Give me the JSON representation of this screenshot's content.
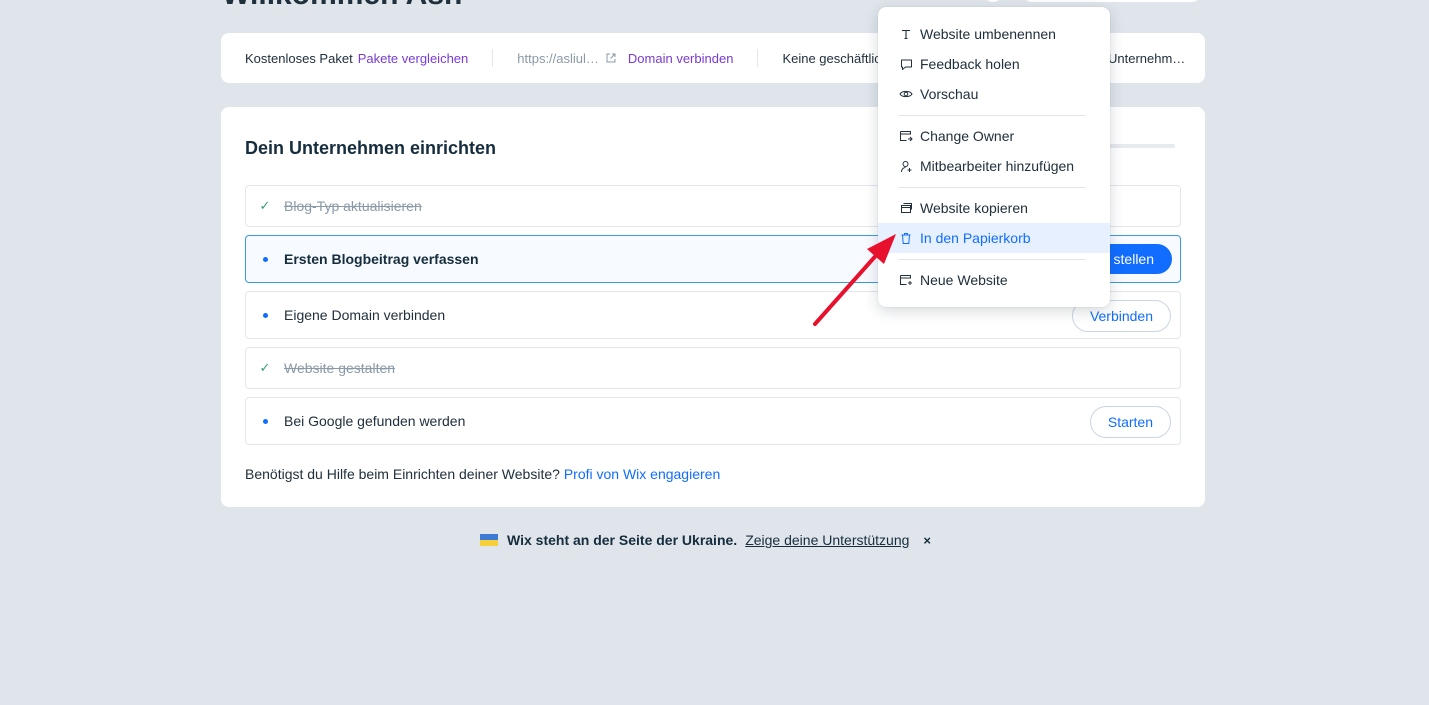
{
  "header": {
    "title_partial": "Willkommen Ash"
  },
  "info_bar": {
    "plan": "Kostenloses Paket",
    "compare_plans": "Pakete vergleichen",
    "url": "https://asliul…",
    "connect_domain": "Domain verbinden",
    "business_email": "Keine geschäftliche",
    "business_name": "Unternehm…"
  },
  "setup": {
    "title": "Dein Unternehmen einrichten",
    "tasks": [
      {
        "label": "Blog-Typ aktualisieren",
        "done": true
      },
      {
        "label": "Ersten Blogbeitrag verfassen",
        "done": false,
        "button": "stellen"
      },
      {
        "label": "Eigene Domain verbinden",
        "done": false,
        "button": "Verbinden"
      },
      {
        "label": "Website gestalten",
        "done": true
      },
      {
        "label": "Bei Google gefunden werden",
        "done": false,
        "button": "Starten"
      }
    ],
    "help_text": "Benötigst du Hilfe beim Einrichten deiner Website?",
    "help_link": "Profi von Wix engagieren"
  },
  "banner": {
    "message": "Wix steht an der Seite der Ukraine.",
    "link": "Zeige deine Unterstützung",
    "close": "×"
  },
  "menu": {
    "items": [
      {
        "label": "Website umbenennen",
        "icon": "text-icon"
      },
      {
        "label": "Feedback holen",
        "icon": "speech-bubble-icon"
      },
      {
        "label": "Vorschau",
        "icon": "eye-icon"
      },
      {
        "label": "Change Owner",
        "icon": "transfer-icon"
      },
      {
        "label": "Mitbearbeiter hinzufügen",
        "icon": "add-person-icon"
      },
      {
        "label": "Website kopieren",
        "icon": "copy-icon"
      },
      {
        "label": "In den Papierkorb",
        "icon": "trash-icon",
        "highlighted": true
      },
      {
        "label": "Neue Website",
        "icon": "new-site-icon"
      }
    ]
  },
  "colors": {
    "background": "#dfe5eb",
    "accent": "#116dff",
    "purple_link": "#7a3bd1",
    "arrow": "#e8112d",
    "highlight": "#e7f0ff"
  }
}
